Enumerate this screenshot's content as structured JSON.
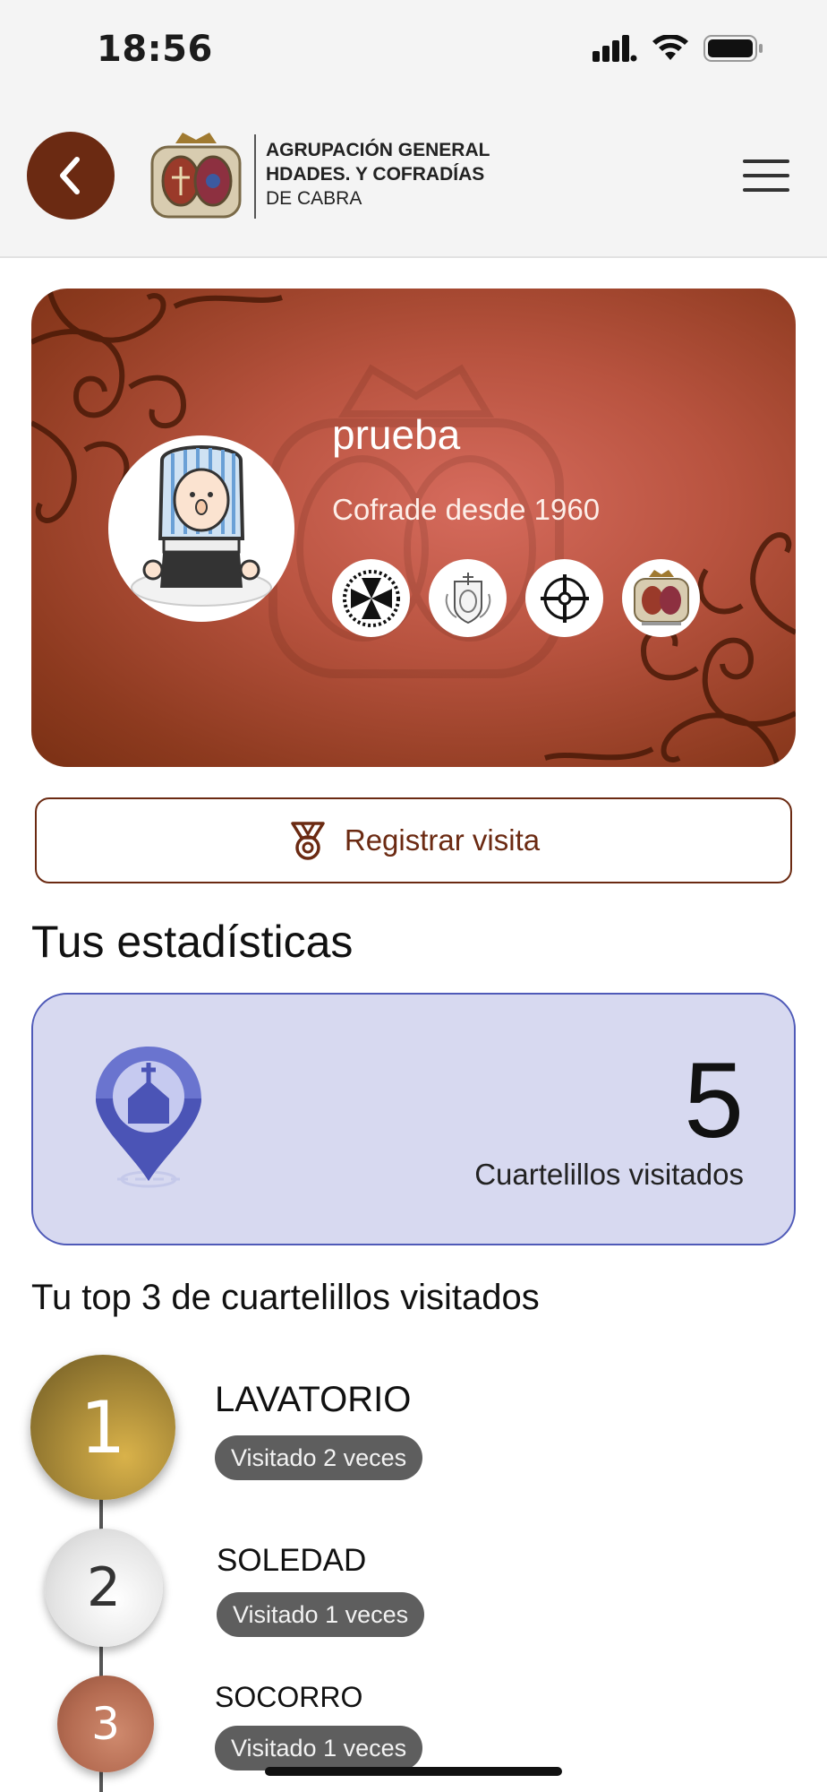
{
  "status_bar": {
    "time": "18:56"
  },
  "header": {
    "logo_line1": "AGRUPACIÓN GENERAL",
    "logo_line2": "HDADES. Y COFRADÍAS",
    "logo_line3": "DE CABRA"
  },
  "profile": {
    "name": "prueba",
    "since": "Cofrade desde 1960",
    "badges": [
      "cofradia-badge-1",
      "cofradia-badge-2",
      "cofradia-badge-3",
      "cofradia-badge-4"
    ]
  },
  "register_button": {
    "label": "Registrar visita"
  },
  "stats": {
    "section_title": "Tus estadísticas",
    "count": "5",
    "count_label": "Cuartelillos visitados"
  },
  "top3": {
    "title": "Tu top 3 de cuartelillos visitados",
    "items": [
      {
        "rank": "1",
        "name": "LAVATORIO",
        "visits": "Visitado 2 veces"
      },
      {
        "rank": "2",
        "name": "SOLEDAD",
        "visits": "Visitado 1 veces"
      },
      {
        "rank": "3",
        "name": "SOCORRO",
        "visits": "Visitado 1 veces"
      }
    ]
  },
  "colors": {
    "brand": "#6b2a12",
    "stats_bg": "#d7d9f0",
    "stats_border": "#4f5ab8",
    "pill_bg": "#5e5e5e"
  }
}
